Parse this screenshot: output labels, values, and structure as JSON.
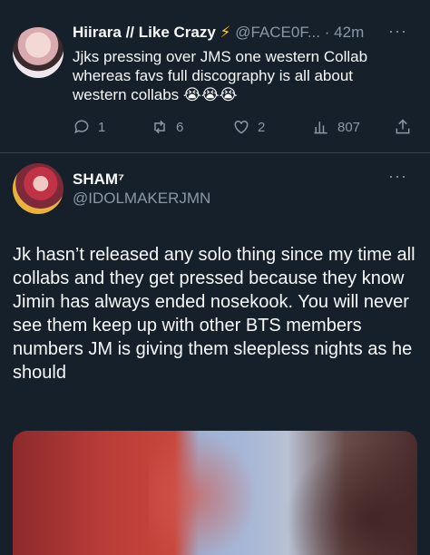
{
  "reply_tweet": {
    "display_name": "Hiirara // Like Crazy",
    "name_emoji": "⚡",
    "handle": "@FACE0F...",
    "separator": "·",
    "time": "42m",
    "text": "Jjks pressing over JMS one western Collab whereas favs full discography is all about western collabs 😭😭😭",
    "stats": {
      "replies": "1",
      "retweets": "6",
      "likes": "2",
      "views": "807"
    },
    "more_label": "···"
  },
  "main_tweet": {
    "display_name": "SHAM⁷",
    "handle": "@IDOLMAKERJMN",
    "more_label": "···",
    "text": "Jk hasn’t released any solo thing since my time all collabs and they get pressed because they know Jimin has always ended nosekook. You will never see them keep up with other BTS members numbers JM is giving them sleepless nights as he should"
  },
  "colors": {
    "background": "#15202b",
    "text": "#f7f9f9",
    "muted": "#8b98a5",
    "divider": "#38444d"
  }
}
